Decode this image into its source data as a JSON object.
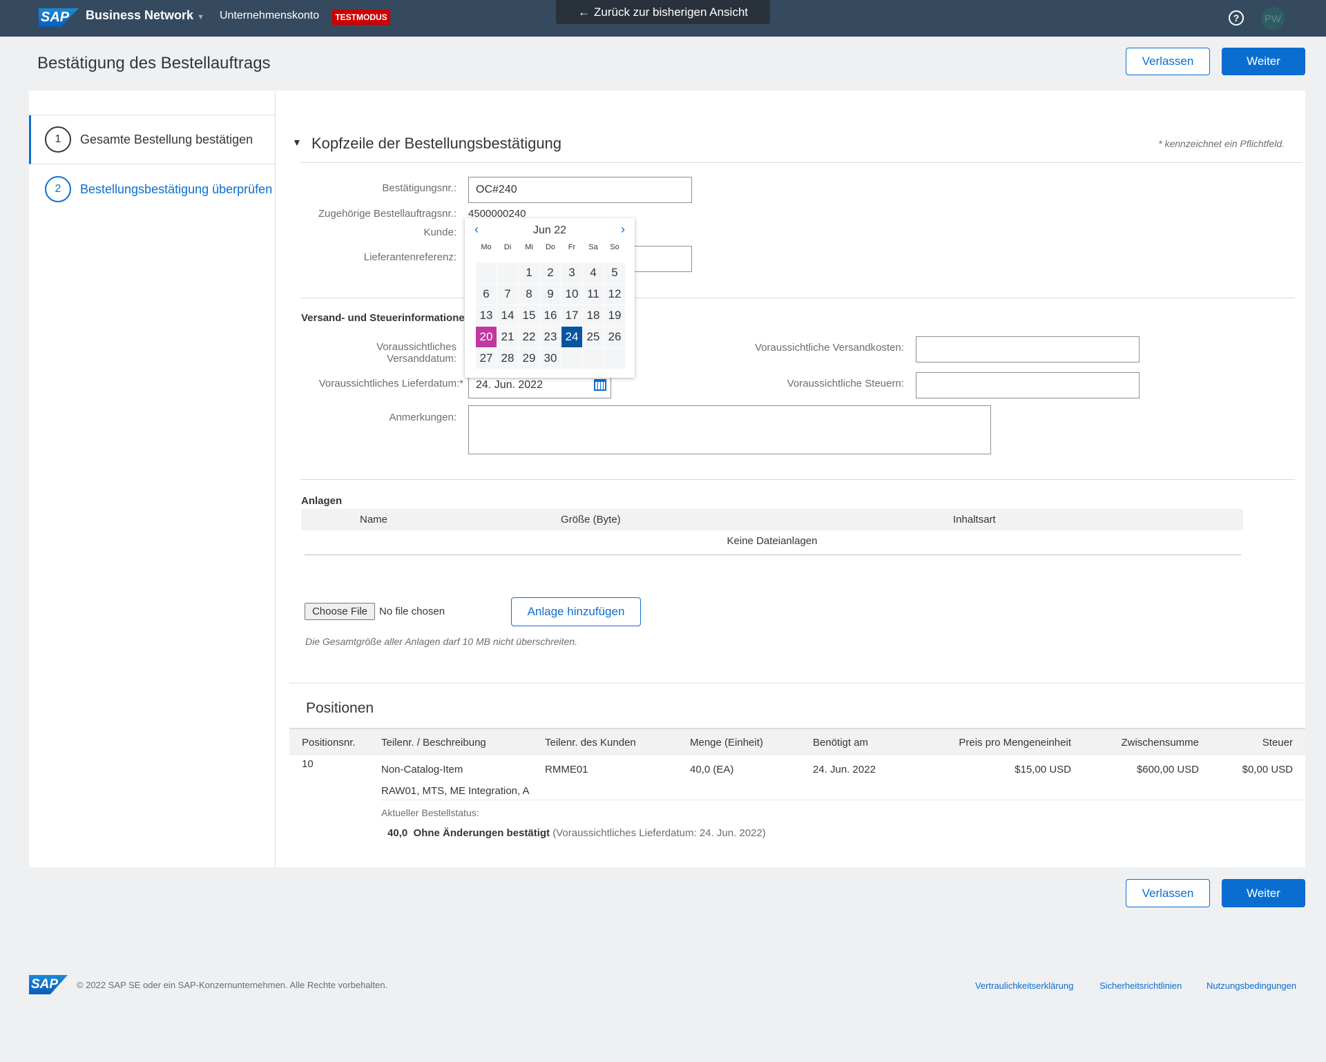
{
  "topbar": {
    "brand": "SAP",
    "product": "Business Network",
    "account": "Unternehmenskonto",
    "mode_badge": "TESTMODUS",
    "back_label": "Zurück zur bisherigen Ansicht",
    "help_icon": "question-circle-icon",
    "avatar": "PW"
  },
  "page": {
    "title": "Bestätigung des Bestellauftrags",
    "leave": "Verlassen",
    "next": "Weiter"
  },
  "steps": [
    {
      "num": "1",
      "label": "Gesamte Bestellung bestätigen"
    },
    {
      "num": "2",
      "label": "Bestellungsbestätigung überprüfen"
    }
  ],
  "header_section": {
    "title": "Kopfzeile der Bestellungsbestätigung",
    "required_note": "* kennzeichnet ein Pflichtfeld.",
    "confirmation_label": "Bestätigungsnr.:",
    "confirmation_value": "OC#240",
    "po_label": "Zugehörige Bestellauftragsnr.:",
    "po_value": "4500000240",
    "customer_label": "Kunde:",
    "supplier_ref_label": "Lieferantenreferenz:",
    "supplier_ref_value": ""
  },
  "shipping": {
    "title": "Versand- und Steuerinformationen",
    "ship_date_label_1": "Voraussichtliches",
    "ship_date_label_2": "Versanddatum:",
    "delivery_label": "Voraussichtliches Lieferdatum:",
    "required_star": "*",
    "delivery_value": "24. Jun. 2022",
    "ship_cost_label": "Voraussichtliche Versandkosten:",
    "ship_cost_value": "",
    "tax_label": "Voraussichtliche Steuern:",
    "tax_value": "",
    "comments_label": "Anmerkungen:",
    "comments_value": ""
  },
  "calendar": {
    "month": "Jun 22",
    "weekdays": [
      "Mo",
      "Di",
      "Mi",
      "Do",
      "Fr",
      "Sa",
      "So"
    ],
    "days": [
      "",
      "",
      "1",
      "2",
      "3",
      "4",
      "5",
      "6",
      "7",
      "8",
      "9",
      "10",
      "11",
      "12",
      "13",
      "14",
      "15",
      "16",
      "17",
      "18",
      "19",
      "20",
      "21",
      "22",
      "23",
      "24",
      "25",
      "26",
      "27",
      "28",
      "29",
      "30",
      "",
      "",
      ""
    ],
    "today": "20",
    "selected": "24",
    "today_color": "#c0399f",
    "selected_color": "#0854a0"
  },
  "attachments": {
    "title": "Anlagen",
    "columns": [
      "Name",
      "Größe (Byte)",
      "Inhaltsart"
    ],
    "empty": "Keine Dateianlagen",
    "choose_file": "Choose File",
    "no_file": "No file chosen",
    "add": "Anlage hinzufügen",
    "note": "Die Gesamtgröße aller Anlagen darf 10 MB nicht überschreiten."
  },
  "positions": {
    "title": "Positionen",
    "columns": [
      "Positionsnr.",
      "Teilenr. / Beschreibung",
      "Teilenr. des Kunden",
      "Menge (Einheit)",
      "Benötigt am",
      "Preis pro Mengeneinheit",
      "Zwischensumme",
      "Steuer"
    ],
    "rows": [
      {
        "pos": "10",
        "part": "Non-Catalog-Item",
        "desc": "RAW01, MTS, ME Integration, A",
        "customer_part": "RMME01",
        "qty": "40,0 (EA)",
        "needed": "24. Jun. 2022",
        "price": "$15,00 USD",
        "subtotal": "$600,00 USD",
        "tax": "$0,00 USD",
        "status_label": "Aktueller Bestellstatus:",
        "status_qty": "40,0",
        "status_text": "Ohne Änderungen bestätigt",
        "status_note": "(Voraussichtliches Lieferdatum: 24. Jun. 2022)"
      }
    ]
  },
  "footer": {
    "brand": "SAP",
    "copyright": "© 2022 SAP SE oder ein SAP-Konzernunternehmen. Alle Rechte vorbehalten.",
    "links": [
      "Vertraulichkeitserklärung",
      "Sicherheitsrichtlinien",
      "Nutzungsbedingungen"
    ]
  }
}
